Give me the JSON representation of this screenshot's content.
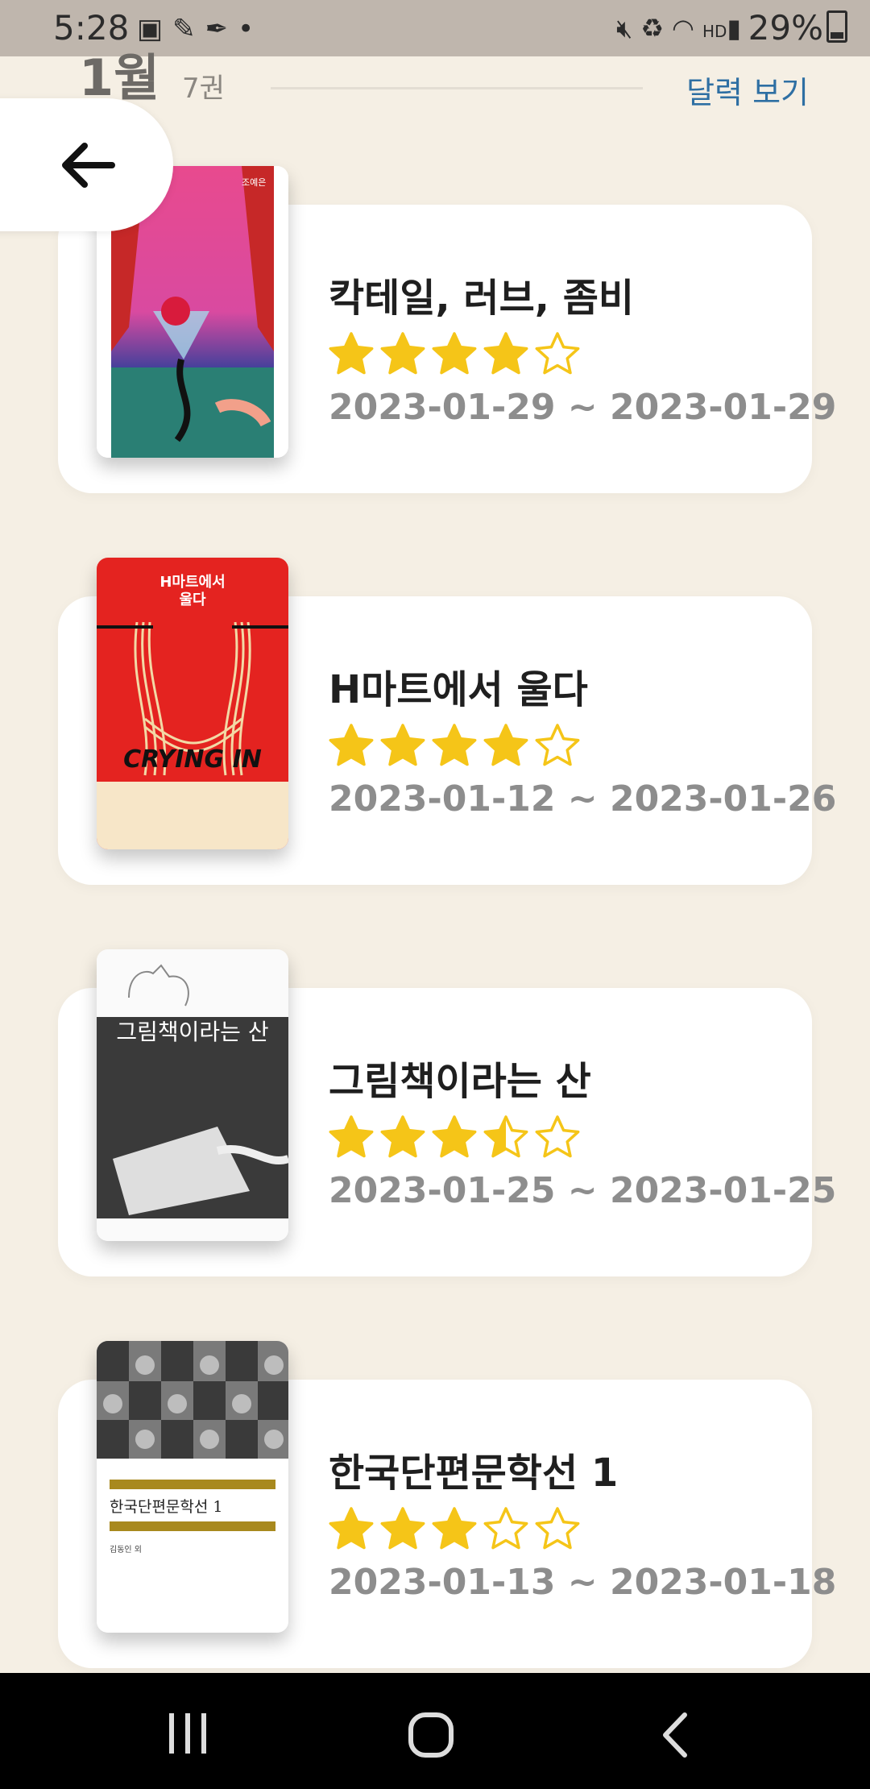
{
  "status_bar": {
    "time": "5:28",
    "left_icons": [
      "image-icon",
      "pen-icon",
      "feather-icon",
      "dot-icon"
    ],
    "right_icons": [
      "mute-icon",
      "recycle-icon",
      "wifi-icon",
      "hd-voice-icon",
      "signal-icon"
    ],
    "battery": "29%"
  },
  "header": {
    "month": "1월",
    "count": "7권",
    "calendar_link": "달력 보기"
  },
  "books": [
    {
      "title": "칵테일, 러브, 좀비",
      "rating": 4,
      "dates": "2023-01-29 ~ 2023-01-29",
      "cover_author": "조예은"
    },
    {
      "title": "H마트에서 울다",
      "rating": 4,
      "dates": "2023-01-12 ~ 2023-01-26",
      "cover_title": "H마트에서\n울다",
      "cover_text": "CRYING IN"
    },
    {
      "title": "그림책이라는 산",
      "rating": 3.5,
      "dates": "2023-01-25 ~ 2023-01-25",
      "cover_title": "그림책이라는 산"
    },
    {
      "title": "한국단편문학선 1",
      "rating": 3,
      "dates": "2023-01-13 ~ 2023-01-18",
      "cover_title": "한국단편문학선 1",
      "cover_author": "김동인 외"
    }
  ],
  "colors": {
    "background": "#f5efe4",
    "star": "#f5c518",
    "link": "#2e6fa3"
  }
}
